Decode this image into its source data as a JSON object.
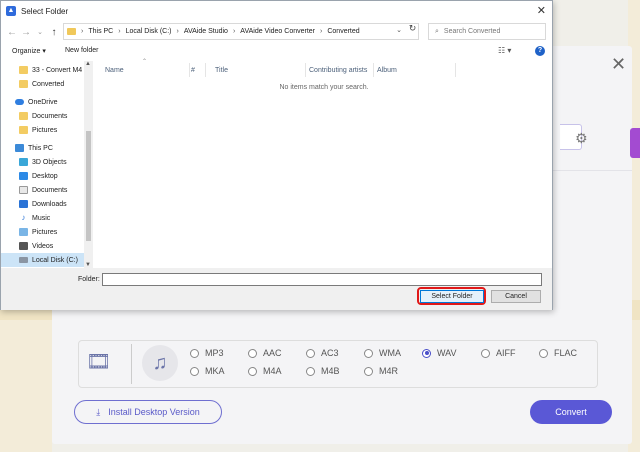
{
  "dialog": {
    "title": "Select Folder",
    "breadcrumb": [
      "This PC",
      "Local Disk (C:)",
      "AVAide Studio",
      "AVAide Video Converter",
      "Converted"
    ],
    "search_placeholder": "Search Converted",
    "toolbar": {
      "organize": "Organize ▾",
      "new_folder": "New folder"
    },
    "nav_items": [
      {
        "label": "33 - Convert M4",
        "icon": "folder-icon"
      },
      {
        "label": "Converted",
        "icon": "folder-icon"
      },
      {
        "label": "OneDrive",
        "icon": "cloud-icon"
      },
      {
        "label": "Documents",
        "icon": "folder-icon"
      },
      {
        "label": "Pictures",
        "icon": "folder-icon"
      },
      {
        "label": "This PC",
        "icon": "computer-icon"
      },
      {
        "label": "3D Objects",
        "icon": "3d-objects-icon"
      },
      {
        "label": "Desktop",
        "icon": "desktop-icon"
      },
      {
        "label": "Documents",
        "icon": "documents-icon"
      },
      {
        "label": "Downloads",
        "icon": "downloads-icon"
      },
      {
        "label": "Music",
        "icon": "music-icon"
      },
      {
        "label": "Pictures",
        "icon": "pictures-icon"
      },
      {
        "label": "Videos",
        "icon": "videos-icon"
      },
      {
        "label": "Local Disk (C:)",
        "icon": "disk-icon"
      }
    ],
    "columns": [
      "Name",
      "#",
      "Title",
      "Contributing artists",
      "Album"
    ],
    "empty_message": "No items match your search.",
    "folder_label": "Folder:",
    "folder_value": "",
    "select_button": "Select Folder",
    "cancel_button": "Cancel"
  },
  "app": {
    "audio_formats": [
      {
        "label": "MP3",
        "selected": false
      },
      {
        "label": "AAC",
        "selected": false
      },
      {
        "label": "AC3",
        "selected": false
      },
      {
        "label": "WMA",
        "selected": false
      },
      {
        "label": "WAV",
        "selected": true
      },
      {
        "label": "AIFF",
        "selected": false
      },
      {
        "label": "FLAC",
        "selected": false
      },
      {
        "label": "MKA",
        "selected": false
      },
      {
        "label": "M4A",
        "selected": false
      },
      {
        "label": "M4B",
        "selected": false
      },
      {
        "label": "M4R",
        "selected": false
      }
    ],
    "install_button": "Install Desktop Version",
    "convert_button": "Convert"
  },
  "colors": {
    "accent": "#5a58d6",
    "highlight": "#e01818",
    "selection": "#cce4f7"
  }
}
